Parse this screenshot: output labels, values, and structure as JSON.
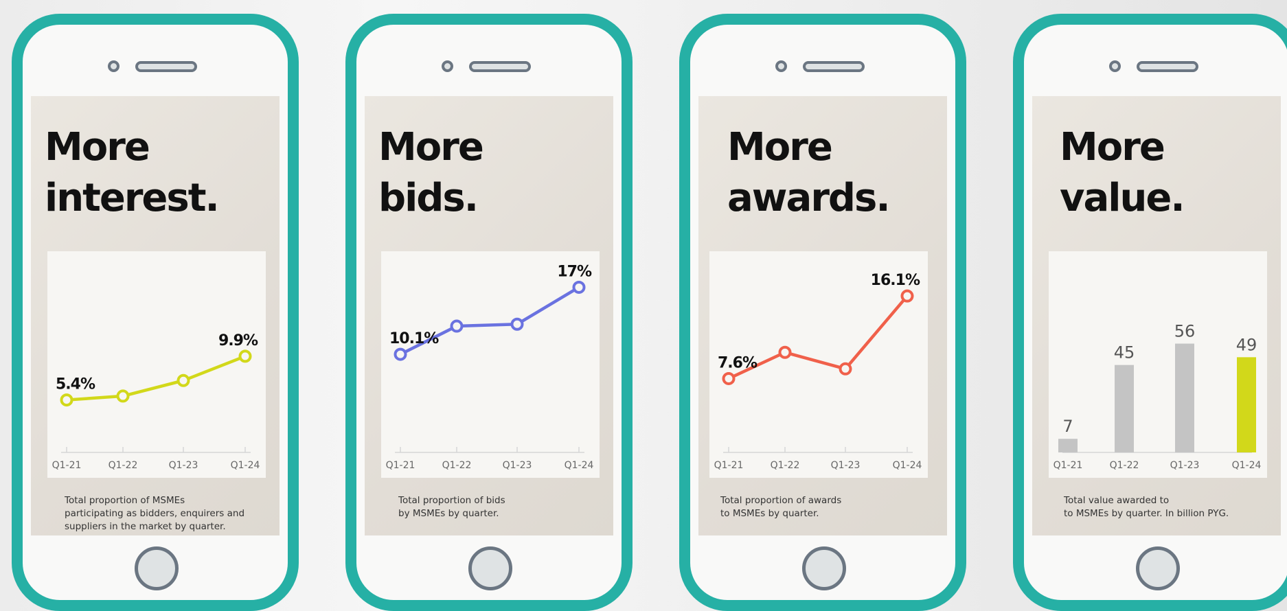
{
  "colors": {
    "frame": "#26b0a5",
    "lime": "#d2d81a",
    "blue": "#6a72e0",
    "red": "#f0604a",
    "bar_gray": "#c4c4c4"
  },
  "panels": [
    {
      "title1": "More",
      "title2": "interest.",
      "caption1": "Total proportion of MSMEs",
      "caption2": "participating as bidders, enquirers and",
      "caption3": "suppliers in the market by quarter."
    },
    {
      "title1": "More",
      "title2": "bids.",
      "caption1": "Total proportion of bids",
      "caption2": "by MSMEs by quarter.",
      "caption3": ""
    },
    {
      "title1": "More",
      "title2": "awards.",
      "caption1": "Total proportion of awards",
      "caption2": "to MSMEs by quarter.",
      "caption3": ""
    },
    {
      "title1": "More",
      "title2": "value.",
      "caption1": "Total value awarded to",
      "caption2": "to MSMEs by quarter. In billion PYG.",
      "caption3": ""
    }
  ],
  "chart_data": [
    {
      "type": "line",
      "categories": [
        "Q1-21",
        "Q1-22",
        "Q1-23",
        "Q1-24"
      ],
      "series": [
        {
          "values": [
            5.4,
            5.8,
            7.4,
            9.9
          ]
        }
      ],
      "labels": [
        "5.4%",
        "",
        "",
        "9.9%"
      ],
      "ylim": [
        0,
        20
      ],
      "grid": false,
      "color": "#d2d81a"
    },
    {
      "type": "line",
      "categories": [
        "Q1-21",
        "Q1-22",
        "Q1-23",
        "Q1-24"
      ],
      "series": [
        {
          "values": [
            10.1,
            13.0,
            13.2,
            17
          ]
        }
      ],
      "labels": [
        "10.1%",
        "",
        "",
        "17%"
      ],
      "ylim": [
        0,
        20
      ],
      "grid": false,
      "color": "#6a72e0"
    },
    {
      "type": "line",
      "categories": [
        "Q1-21",
        "Q1-22",
        "Q1-23",
        "Q1-24"
      ],
      "series": [
        {
          "values": [
            7.6,
            10.3,
            8.6,
            16.1
          ]
        }
      ],
      "labels": [
        "7.6%",
        "",
        "",
        "16.1%"
      ],
      "ylim": [
        0,
        20
      ],
      "grid": false,
      "color": "#f0604a"
    },
    {
      "type": "bar",
      "categories": [
        "Q1-21",
        "Q1-22",
        "Q1-23",
        "Q1-24"
      ],
      "values": [
        7,
        45,
        56,
        49
      ],
      "labels": [
        "7",
        "45",
        "56",
        "49"
      ],
      "ylim": [
        0,
        100
      ],
      "grid": false,
      "colors": [
        "#c4c4c4",
        "#c4c4c4",
        "#c4c4c4",
        "#d2d81a"
      ]
    }
  ]
}
